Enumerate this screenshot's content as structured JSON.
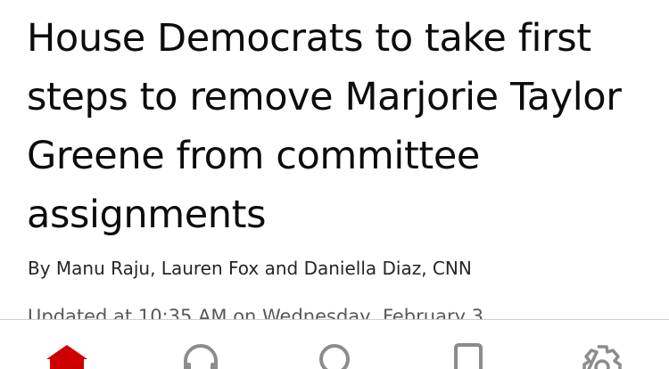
{
  "article": {
    "headline": "House Democrats to take first steps to remove Marjorie Taylor Greene from committee assignments",
    "byline": "By Manu Raju, Lauren Fox and Daniella Diaz, CNN",
    "timestamp": "Updated at 10:35 AM on Wednesday, February 3"
  },
  "tabbar": {
    "accent_color": "#cc0000",
    "inactive_color": "#8c8c8c",
    "tabs": [
      {
        "icon": "home-icon",
        "active": true
      },
      {
        "icon": "headphones-icon",
        "active": false
      },
      {
        "icon": "search-icon",
        "active": false
      },
      {
        "icon": "bookmark-icon",
        "active": false
      },
      {
        "icon": "gear-icon",
        "active": false
      }
    ]
  }
}
